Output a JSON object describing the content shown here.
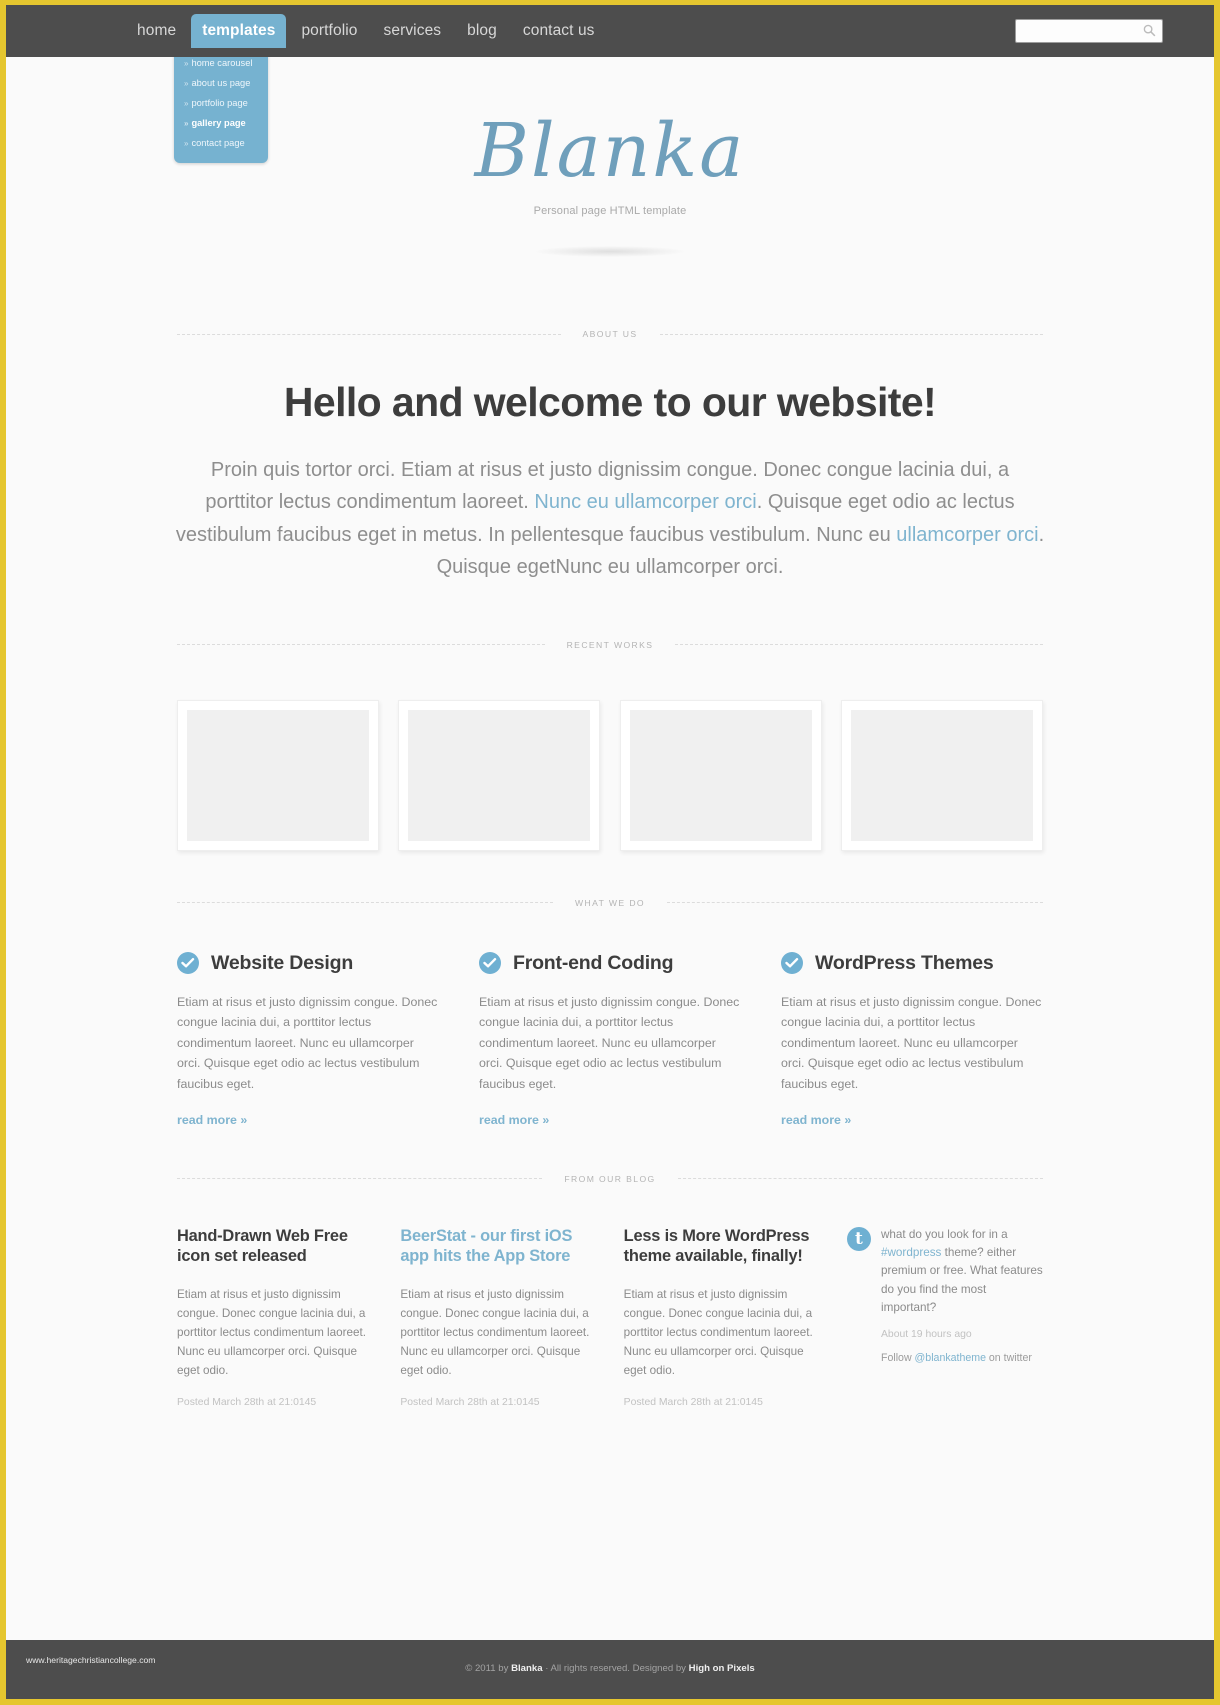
{
  "theme": {
    "accent": "#76b2d0",
    "border": "#e5c62f",
    "dark": "#4d4d4d",
    "heading": "#3d3d3d",
    "body_text": "#8b8b8b"
  },
  "nav": {
    "items": [
      {
        "label": "home",
        "active": false
      },
      {
        "label": "templates",
        "active": true
      },
      {
        "label": "portfolio",
        "active": false
      },
      {
        "label": "services",
        "active": false
      },
      {
        "label": "blog",
        "active": false
      },
      {
        "label": "contact us",
        "active": false
      }
    ],
    "dropdown": [
      {
        "label": "home carousel",
        "bold": false
      },
      {
        "label": "about us page",
        "bold": false
      },
      {
        "label": "portfolio page",
        "bold": false
      },
      {
        "label": "gallery page",
        "bold": true
      },
      {
        "label": "contact page",
        "bold": false
      }
    ],
    "bullet": "»"
  },
  "search": {
    "value": "",
    "placeholder": "",
    "icon": "search-icon"
  },
  "brand": {
    "logo": "Blanka",
    "tagline": "Personal page HTML template"
  },
  "sections": {
    "about_label": "ABOUT US",
    "works_label": "RECENT WORKS",
    "whatwedo_label": "WHAT WE DO",
    "blog_label": "FROM OUR BLOG"
  },
  "about": {
    "heading": "Hello and welcome to our website!",
    "p1": "Proin quis tortor orci. Etiam at risus et justo dignissim congue. Donec congue lacinia dui, a porttitor lectus condimentum laoreet. ",
    "link1": "Nunc eu ullamcorper orci",
    "p2": ". Quisque eget odio ac lectus vestibulum faucibus eget in metus. In pellentesque faucibus vestibulum. Nunc eu ",
    "link2": "ullamcorper orci",
    "p3": ". Quisque egetNunc eu ullamcorper orci."
  },
  "works": [
    {
      "name": "work-thumbnail-1"
    },
    {
      "name": "work-thumbnail-2"
    },
    {
      "name": "work-thumbnail-3"
    },
    {
      "name": "work-thumbnail-4"
    }
  ],
  "services": [
    {
      "title": "Website Design",
      "text": "Etiam at risus et justo dignissim congue. Donec congue lacinia dui, a porttitor lectus condimentum laoreet. Nunc eu ullamcorper orci. Quisque eget odio ac lectus vestibulum faucibus eget.",
      "read_more": "read more »"
    },
    {
      "title": "Front-end Coding",
      "text": "Etiam at risus et justo dignissim congue. Donec congue lacinia dui, a porttitor lectus condimentum laoreet. Nunc eu ullamcorper orci. Quisque eget odio ac lectus vestibulum faucibus eget.",
      "read_more": "read more »"
    },
    {
      "title": "WordPress Themes",
      "text": "Etiam at risus et justo dignissim congue. Donec congue lacinia dui, a porttitor lectus condimentum laoreet. Nunc eu ullamcorper orci. Quisque eget odio ac lectus vestibulum faucibus eget.",
      "read_more": "read more »"
    }
  ],
  "blog_posts": [
    {
      "title": "Hand-Drawn Web Free icon set released",
      "is_link": false,
      "text": "Etiam at risus et justo dignissim congue. Donec congue lacinia dui, a porttitor lectus condimentum laoreet. Nunc eu ullamcorper orci. Quisque eget odio.",
      "date": "Posted March 28th at 21:0145"
    },
    {
      "title": "BeerStat - our first iOS app hits the App Store",
      "is_link": true,
      "text": "Etiam at risus et justo dignissim congue. Donec congue lacinia dui, a porttitor lectus condimentum laoreet. Nunc eu ullamcorper orci. Quisque eget odio.",
      "date": "Posted March 28th at 21:0145"
    },
    {
      "title": "Less is More WordPress theme available, finally!",
      "is_link": false,
      "text": "Etiam at risus et justo dignissim congue. Donec congue lacinia dui, a porttitor lectus condimentum laoreet. Nunc eu ullamcorper orci. Quisque eget odio.",
      "date": "Posted March 28th at 21:0145"
    }
  ],
  "tweet": {
    "icon_glyph": "t",
    "text_before": "what do you look for in a ",
    "hashtag": "#wordpress",
    "text_after": " theme? either premium or free. What features do you find the most important?",
    "time": "About 19 hours ago",
    "follow_prefix": "Follow ",
    "follow_handle": "@blankatheme",
    "follow_suffix": " on twitter"
  },
  "footer": {
    "site": "www.heritagechristiancollege.com",
    "copy_prefix": "© 2011 by ",
    "brand": "Blanka",
    "copy_mid": " · All rights reserved.   Designed by ",
    "designer": "High on Pixels"
  }
}
